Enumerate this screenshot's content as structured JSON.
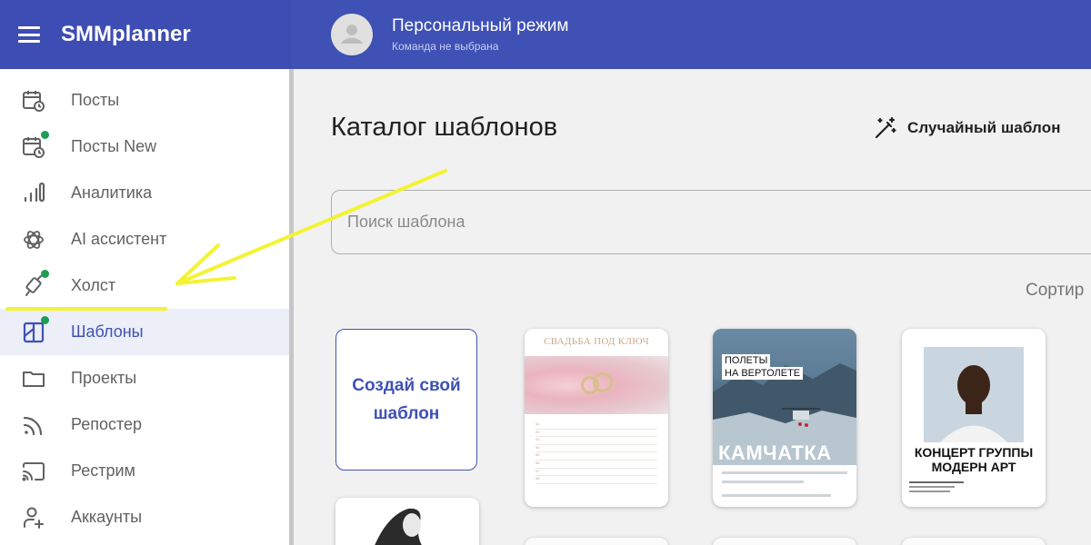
{
  "app": {
    "brand": "SMMplanner"
  },
  "account": {
    "title": "Персональный режим",
    "subtitle": "Команда не выбрана"
  },
  "sidebar": {
    "items": [
      {
        "label": "Посты",
        "icon": "calendar-clock-icon",
        "dot": false,
        "active": false
      },
      {
        "label": "Посты New",
        "icon": "calendar-clock-icon",
        "dot": true,
        "active": false
      },
      {
        "label": "Аналитика",
        "icon": "bar-chart-icon",
        "dot": false,
        "active": false
      },
      {
        "label": "AI ассистент",
        "icon": "ai-knot-icon",
        "dot": false,
        "active": false
      },
      {
        "label": "Холст",
        "icon": "canvas-pen-icon",
        "dot": true,
        "active": false
      },
      {
        "label": "Шаблоны",
        "icon": "template-layout-icon",
        "dot": true,
        "active": true
      },
      {
        "label": "Проекты",
        "icon": "folder-icon",
        "dot": false,
        "active": false
      },
      {
        "label": "Репостер",
        "icon": "rss-icon",
        "dot": false,
        "active": false
      },
      {
        "label": "Рестрим",
        "icon": "cast-icon",
        "dot": false,
        "active": false
      },
      {
        "label": "Аккаунты",
        "icon": "add-user-icon",
        "dot": false,
        "active": false
      }
    ]
  },
  "main": {
    "title": "Каталог шаблонов",
    "random_button": "Случайный шаблон",
    "search_placeholder": "Поиск шаблона",
    "sort_label": "Сортир",
    "create_card": "Создай свой шаблон"
  },
  "templates": [
    {
      "title": "СВАДЬБА ПОД КЛЮЧ",
      "lines": [
        "01",
        "02",
        "03",
        "04",
        "05",
        "06",
        "07",
        "08"
      ]
    },
    {
      "tag1": "ПОЛЕТЫ",
      "tag2": "НА ВЕРТОЛЕТЕ",
      "big": "КАМЧАТКА"
    },
    {
      "title1": "КОНЦЕРТ ГРУППЫ",
      "title2": "МОДЕРН АРТ"
    }
  ],
  "colors": {
    "header": "#3f51b5",
    "accent": "#3f51b5",
    "badge": "#1f9d55",
    "annotation": "#f3f335"
  }
}
